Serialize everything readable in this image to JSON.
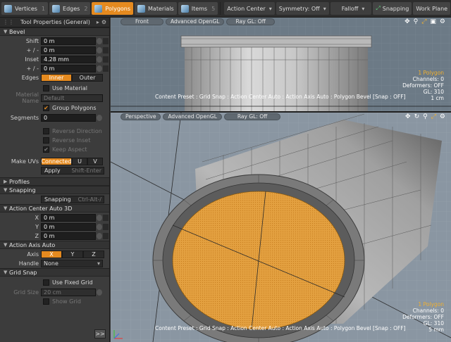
{
  "toolbar": {
    "vertices": {
      "label": "Vertices",
      "num": "1"
    },
    "edges": {
      "label": "Edges",
      "num": "2"
    },
    "polygons": {
      "label": "Polygons"
    },
    "materials": {
      "label": "Materials"
    },
    "items": {
      "label": "Items",
      "num": "5"
    },
    "action_center": "Action Center",
    "symmetry": "Symmetry: Off",
    "falloff": "Falloff",
    "snapping": "Snapping",
    "work_plane": "Work Plane"
  },
  "panel": {
    "title": "Tool Properties (General)",
    "bevel": {
      "header": "Bevel",
      "shift_label": "Shift",
      "shift_value": "0 m",
      "pm1_label": "+ / -",
      "pm1_value": "0 m",
      "inset_label": "Inset",
      "inset_value": "4.28 mm",
      "pm2_label": "+ / -",
      "pm2_value": "0 m",
      "edges_label": "Edges",
      "edges_inner": "Inner",
      "edges_outer": "Outer",
      "use_material": "Use Material",
      "material_name_label": "Material Name",
      "material_name_value": "Default",
      "group_polygons": "Group Polygons",
      "segments_label": "Segments",
      "segments_value": "0",
      "reverse_direction": "Reverse Direction",
      "reverse_inset": "Reverse Inset",
      "keep_aspect": "Keep Aspect",
      "make_uvs_label": "Make UVs",
      "uv_connected": "Connected",
      "uv_u": "U",
      "uv_v": "V",
      "apply_label": "Apply",
      "apply_hint": "Shift-Enter"
    },
    "profiles": {
      "header": "Profiles"
    },
    "snapping": {
      "header": "Snapping",
      "button": "Snapping",
      "hint": "Ctrl-Alt-/"
    },
    "action_center": {
      "header": "Action Center Auto 3D",
      "x_label": "X",
      "x_value": "0 m",
      "y_label": "Y",
      "y_value": "0 m",
      "z_label": "Z",
      "z_value": "0 m"
    },
    "action_axis": {
      "header": "Action Axis Auto",
      "axis_label": "Axis",
      "x": "X",
      "y": "Y",
      "z": "Z",
      "handle_label": "Handle",
      "handle_value": "None"
    },
    "grid_snap": {
      "header": "Grid Snap",
      "use_fixed_grid": "Use Fixed Grid",
      "grid_size_label": "Grid Size",
      "grid_size_value": "20 cm",
      "show_grid": "Show Grid"
    },
    "expand": ">>"
  },
  "viewport_top": {
    "tabs": [
      "Front",
      "Advanced OpenGL",
      "Ray GL: Off"
    ],
    "info": [
      "1 Polygon",
      "Channels: 0",
      "Deformers: OFF",
      "GL: 310",
      "1 cm"
    ],
    "status": "Content Preset : Grid Snap : Action Center Auto : Action Axis Auto : Polygon Bevel  [Snap : OFF]"
  },
  "viewport_bottom": {
    "tabs": [
      "Perspective",
      "Advanced OpenGL",
      "Ray GL: Off"
    ],
    "info": [
      "1 Polygon",
      "Channels: 0",
      "Deformers: OFF",
      "GL: 310",
      "5 mm"
    ],
    "status": "Content Preset : Grid Snap : Action Center Auto : Action Axis Auto : Polygon Bevel  [Snap : OFF]"
  },
  "colors": {
    "accent": "#e58a1f",
    "selection": "#e3a040"
  }
}
